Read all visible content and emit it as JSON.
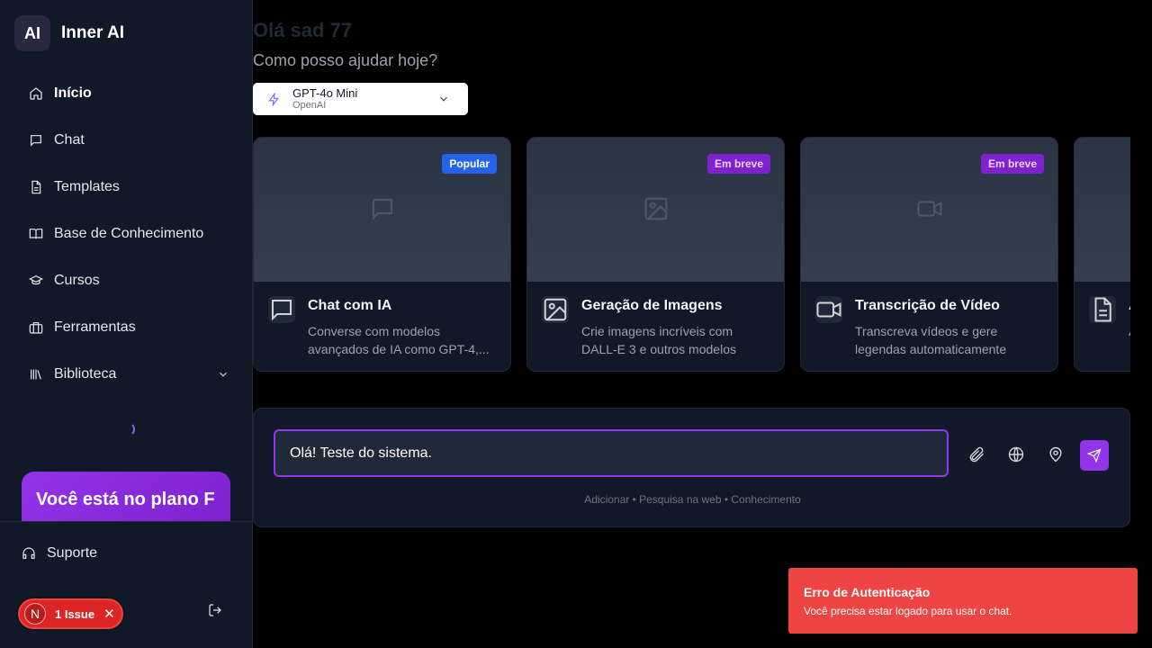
{
  "brand": {
    "logo": "AI",
    "name": "Inner AI"
  },
  "nav": [
    {
      "label": "Início",
      "icon": "home-icon",
      "active": true
    },
    {
      "label": "Chat",
      "icon": "message-icon"
    },
    {
      "label": "Templates",
      "icon": "file-text-icon"
    },
    {
      "label": "Base de Conhecimento",
      "icon": "book-open-icon"
    },
    {
      "label": "Cursos",
      "icon": "graduation-cap-icon"
    },
    {
      "label": "Ferramentas",
      "icon": "briefcase-icon"
    },
    {
      "label": "Biblioteca",
      "icon": "library-icon",
      "expandable": true
    }
  ],
  "plan": {
    "text": "Você está no plano F"
  },
  "footer": {
    "support_label": "Suporte"
  },
  "issue": {
    "avatar": "N",
    "label": "1 Issue",
    "close": "✕"
  },
  "main": {
    "greeting": "Olá sad 77",
    "subtitle": "Como posso ajudar hoje?",
    "model": {
      "name": "GPT-4o Mini",
      "provider": "OpenAI"
    }
  },
  "cards": [
    {
      "title": "Chat com IA",
      "desc": "Converse com modelos avançados de IA como GPT-4,...",
      "badge": "Popular",
      "badge_color": "#2563eb",
      "icon": "message-icon"
    },
    {
      "title": "Geração de Imagens",
      "desc": "Crie imagens incríveis com DALL-E 3 e outros modelos",
      "badge": "Em breve",
      "badge_color": "#7e22ce",
      "icon": "image-icon"
    },
    {
      "title": "Transcrição de Vídeo",
      "desc": "Transcreva vídeos e gere legendas automaticamente",
      "badge": "Em breve",
      "badge_color": "#7e22ce",
      "icon": "video-icon"
    },
    {
      "title": "A",
      "desc": "A",
      "badge": "",
      "icon": "file-text-icon"
    }
  ],
  "chat": {
    "input_value": "Olá! Teste do sistema.",
    "hint": "Adicionar • Pesquisa na web • Conhecimento"
  },
  "toast": {
    "title": "Erro de Autenticação",
    "message": "Você precisa estar logado para usar o chat."
  },
  "colors": {
    "accent": "#9333ea",
    "sidebar_bg": "#111827",
    "error": "#ef4444"
  }
}
